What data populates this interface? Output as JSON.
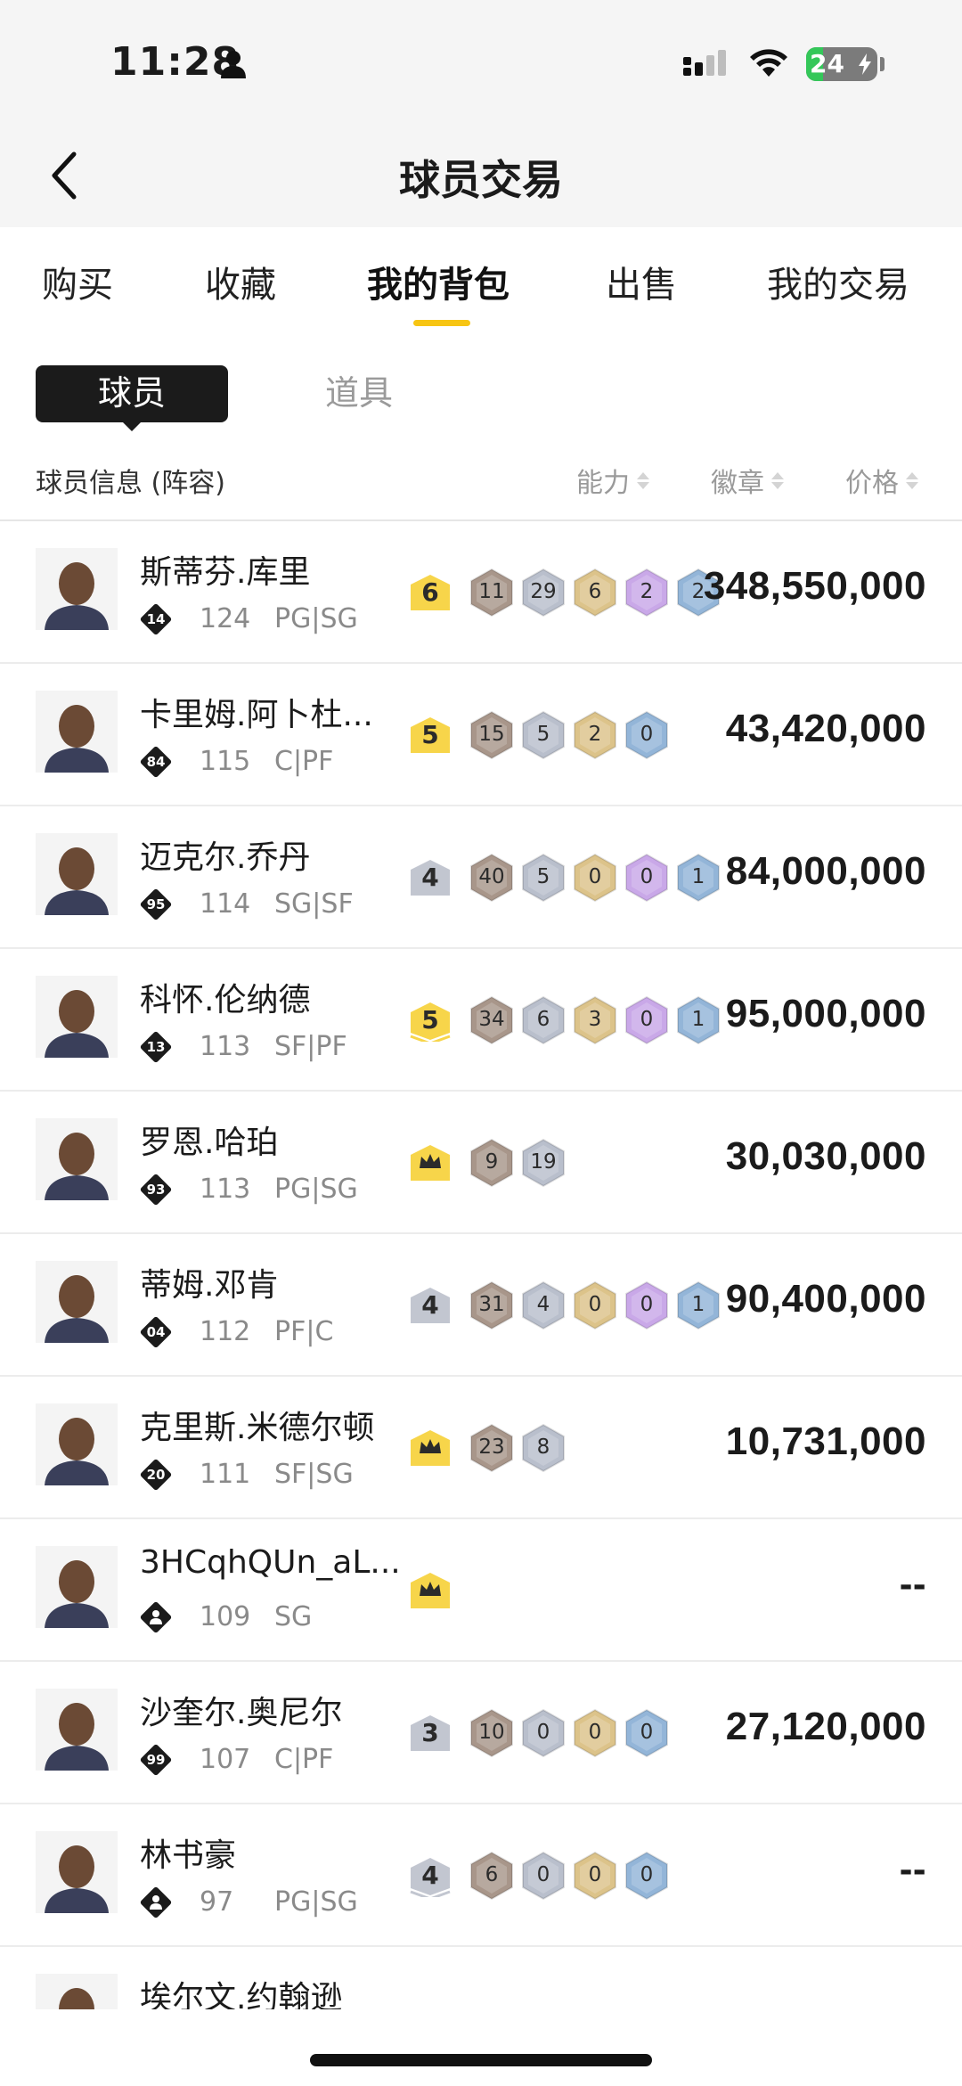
{
  "status_bar": {
    "time": "11:28",
    "battery": "24",
    "battery_level": 0.24,
    "icons": [
      "person-icon",
      "cellular-signal-icon",
      "wifi-icon",
      "battery-charging-icon"
    ]
  },
  "nav": {
    "title": "球员交易",
    "back_icon": "chevron-left-icon"
  },
  "tabs": [
    {
      "label": "购买",
      "active": false
    },
    {
      "label": "收藏",
      "active": false
    },
    {
      "label": "我的背包",
      "active": true
    },
    {
      "label": "出售",
      "active": false
    },
    {
      "label": "我的交易",
      "active": false
    }
  ],
  "segments": [
    {
      "label": "球员",
      "active": true
    },
    {
      "label": "道具",
      "active": false
    }
  ],
  "table_header": {
    "info": "球员信息 (阵容)",
    "ability": "能力",
    "badges": "徽章",
    "price": "价格"
  },
  "colors": {
    "accent_yellow": "#f7c513",
    "tier_gold": "#f7d54a",
    "tier_silver": "#c2c6d0",
    "badge_bronze": "#a8968a",
    "badge_silver": "#b9bfcc",
    "badge_gold": "#dcc38a",
    "badge_purple": "#c9a8e8",
    "badge_blue": "#93b5d8"
  },
  "players": [
    {
      "name": "斯蒂芬.库里",
      "jersey": "14",
      "rating": "124",
      "position": "PG|SG",
      "tier": "6",
      "tier_color": "gold",
      "tier_style": "plain",
      "badges": [
        {
          "v": "11",
          "c": "bronze"
        },
        {
          "v": "29",
          "c": "silver"
        },
        {
          "v": "6",
          "c": "gold"
        },
        {
          "v": "2",
          "c": "purple"
        },
        {
          "v": "2",
          "c": "blue"
        }
      ],
      "price": "348,550,000"
    },
    {
      "name": "卡里姆.阿卜杜...",
      "jersey": "84",
      "rating": "115",
      "position": "C|PF",
      "tier": "5",
      "tier_color": "gold",
      "tier_style": "plain",
      "badges": [
        {
          "v": "15",
          "c": "bronze"
        },
        {
          "v": "5",
          "c": "silver"
        },
        {
          "v": "2",
          "c": "gold"
        },
        {
          "v": "0",
          "c": "blue"
        }
      ],
      "price": "43,420,000"
    },
    {
      "name": "迈克尔.乔丹",
      "jersey": "95",
      "rating": "114",
      "position": "SG|SF",
      "tier": "4",
      "tier_color": "silver",
      "tier_style": "plain",
      "badges": [
        {
          "v": "40",
          "c": "bronze"
        },
        {
          "v": "5",
          "c": "silver"
        },
        {
          "v": "0",
          "c": "gold"
        },
        {
          "v": "0",
          "c": "purple"
        },
        {
          "v": "1",
          "c": "blue"
        }
      ],
      "price": "84,000,000"
    },
    {
      "name": "科怀.伦纳德",
      "jersey": "13",
      "rating": "113",
      "position": "SF|PF",
      "tier": "5",
      "tier_color": "gold",
      "tier_style": "chevron",
      "badges": [
        {
          "v": "34",
          "c": "bronze"
        },
        {
          "v": "6",
          "c": "silver"
        },
        {
          "v": "3",
          "c": "gold"
        },
        {
          "v": "0",
          "c": "purple"
        },
        {
          "v": "1",
          "c": "blue"
        }
      ],
      "price": "95,000,000"
    },
    {
      "name": "罗恩.哈珀",
      "jersey": "93",
      "rating": "113",
      "position": "PG|SG",
      "tier": "",
      "tier_color": "gold",
      "tier_style": "crown",
      "badges": [
        {
          "v": "9",
          "c": "bronze"
        },
        {
          "v": "19",
          "c": "silver"
        }
      ],
      "price": "30,030,000"
    },
    {
      "name": "蒂姆.邓肯",
      "jersey": "04",
      "rating": "112",
      "position": "PF|C",
      "tier": "4",
      "tier_color": "silver",
      "tier_style": "plain",
      "badges": [
        {
          "v": "31",
          "c": "bronze"
        },
        {
          "v": "4",
          "c": "silver"
        },
        {
          "v": "0",
          "c": "gold"
        },
        {
          "v": "0",
          "c": "purple"
        },
        {
          "v": "1",
          "c": "blue"
        }
      ],
      "price": "90,400,000"
    },
    {
      "name": "克里斯.米德尔顿",
      "jersey": "20",
      "rating": "111",
      "position": "SF|SG",
      "tier": "",
      "tier_color": "gold",
      "tier_style": "crown",
      "badges": [
        {
          "v": "23",
          "c": "bronze"
        },
        {
          "v": "8",
          "c": "silver"
        }
      ],
      "price": "10,731,000"
    },
    {
      "name": "3HCqhQUn_aL...",
      "jersey": "",
      "rating": "109",
      "position": "SG",
      "tier": "",
      "tier_color": "gold",
      "tier_style": "crown",
      "badges": [],
      "price": "--"
    },
    {
      "name": "沙奎尔.奥尼尔",
      "jersey": "99",
      "rating": "107",
      "position": "C|PF",
      "tier": "3",
      "tier_color": "silver",
      "tier_style": "plain",
      "badges": [
        {
          "v": "10",
          "c": "bronze"
        },
        {
          "v": "0",
          "c": "silver"
        },
        {
          "v": "0",
          "c": "gold"
        },
        {
          "v": "0",
          "c": "blue"
        }
      ],
      "price": "27,120,000"
    },
    {
      "name": "林书豪",
      "jersey": "",
      "rating": "97",
      "position": "PG|SG",
      "tier": "4",
      "tier_color": "silver",
      "tier_style": "chevron",
      "badges": [
        {
          "v": "6",
          "c": "bronze"
        },
        {
          "v": "0",
          "c": "silver"
        },
        {
          "v": "0",
          "c": "gold"
        },
        {
          "v": "0",
          "c": "blue"
        }
      ],
      "price": "--"
    },
    {
      "name": "埃尔文.约翰逊",
      "jersey": "",
      "rating": "",
      "position": "",
      "tier": "",
      "tier_color": "silver",
      "tier_style": "plain",
      "badges": [],
      "price": ""
    }
  ]
}
